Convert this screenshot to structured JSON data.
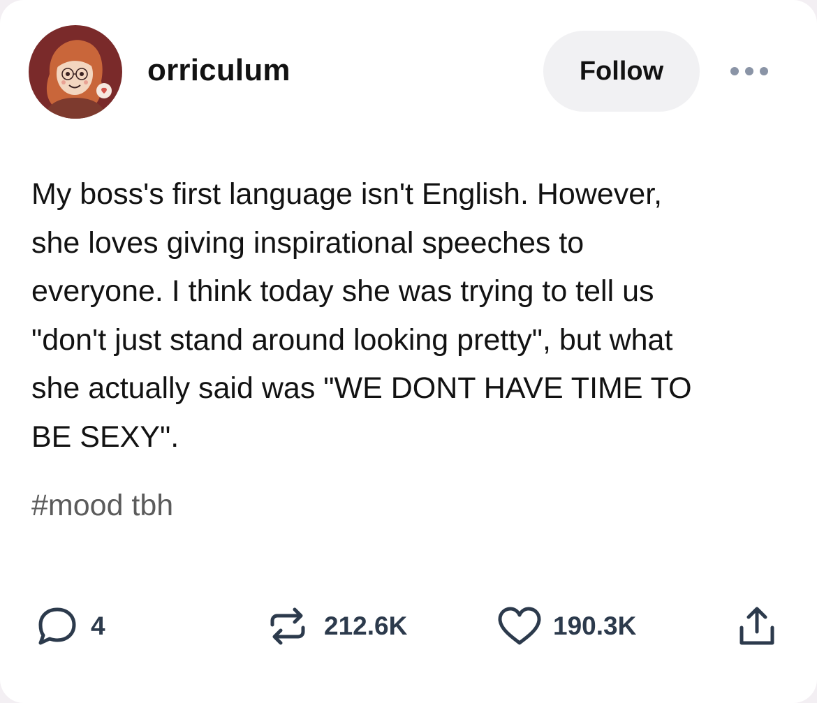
{
  "author": {
    "username": "orriculum",
    "avatar_icon": "avatar-portrait"
  },
  "header": {
    "follow_label": "Follow",
    "more_icon": "ellipsis-icon"
  },
  "post": {
    "lines": [
      "My boss's first language isn't English. However,",
      "she loves giving inspirational speeches to",
      "everyone. I think today she was trying to tell us",
      "\"don't just stand around looking pretty\", but what",
      "she actually said was \"WE DONT HAVE TIME TO",
      "BE SEXY\"."
    ],
    "tags": [
      "#mood tbh"
    ]
  },
  "footer": {
    "comments": {
      "icon": "comment-bubble-icon",
      "count": "4"
    },
    "reblogs": {
      "icon": "reblog-icon",
      "count": "212.6K"
    },
    "likes": {
      "icon": "heart-icon",
      "count": "190.3K"
    },
    "share": {
      "icon": "share-icon"
    }
  },
  "colors": {
    "text": "#121212",
    "tag": "#5b5b5b",
    "footer": "#2c3a4c",
    "follow_bg": "#f1f1f3",
    "avatar_bg": "#7a2a2a"
  }
}
